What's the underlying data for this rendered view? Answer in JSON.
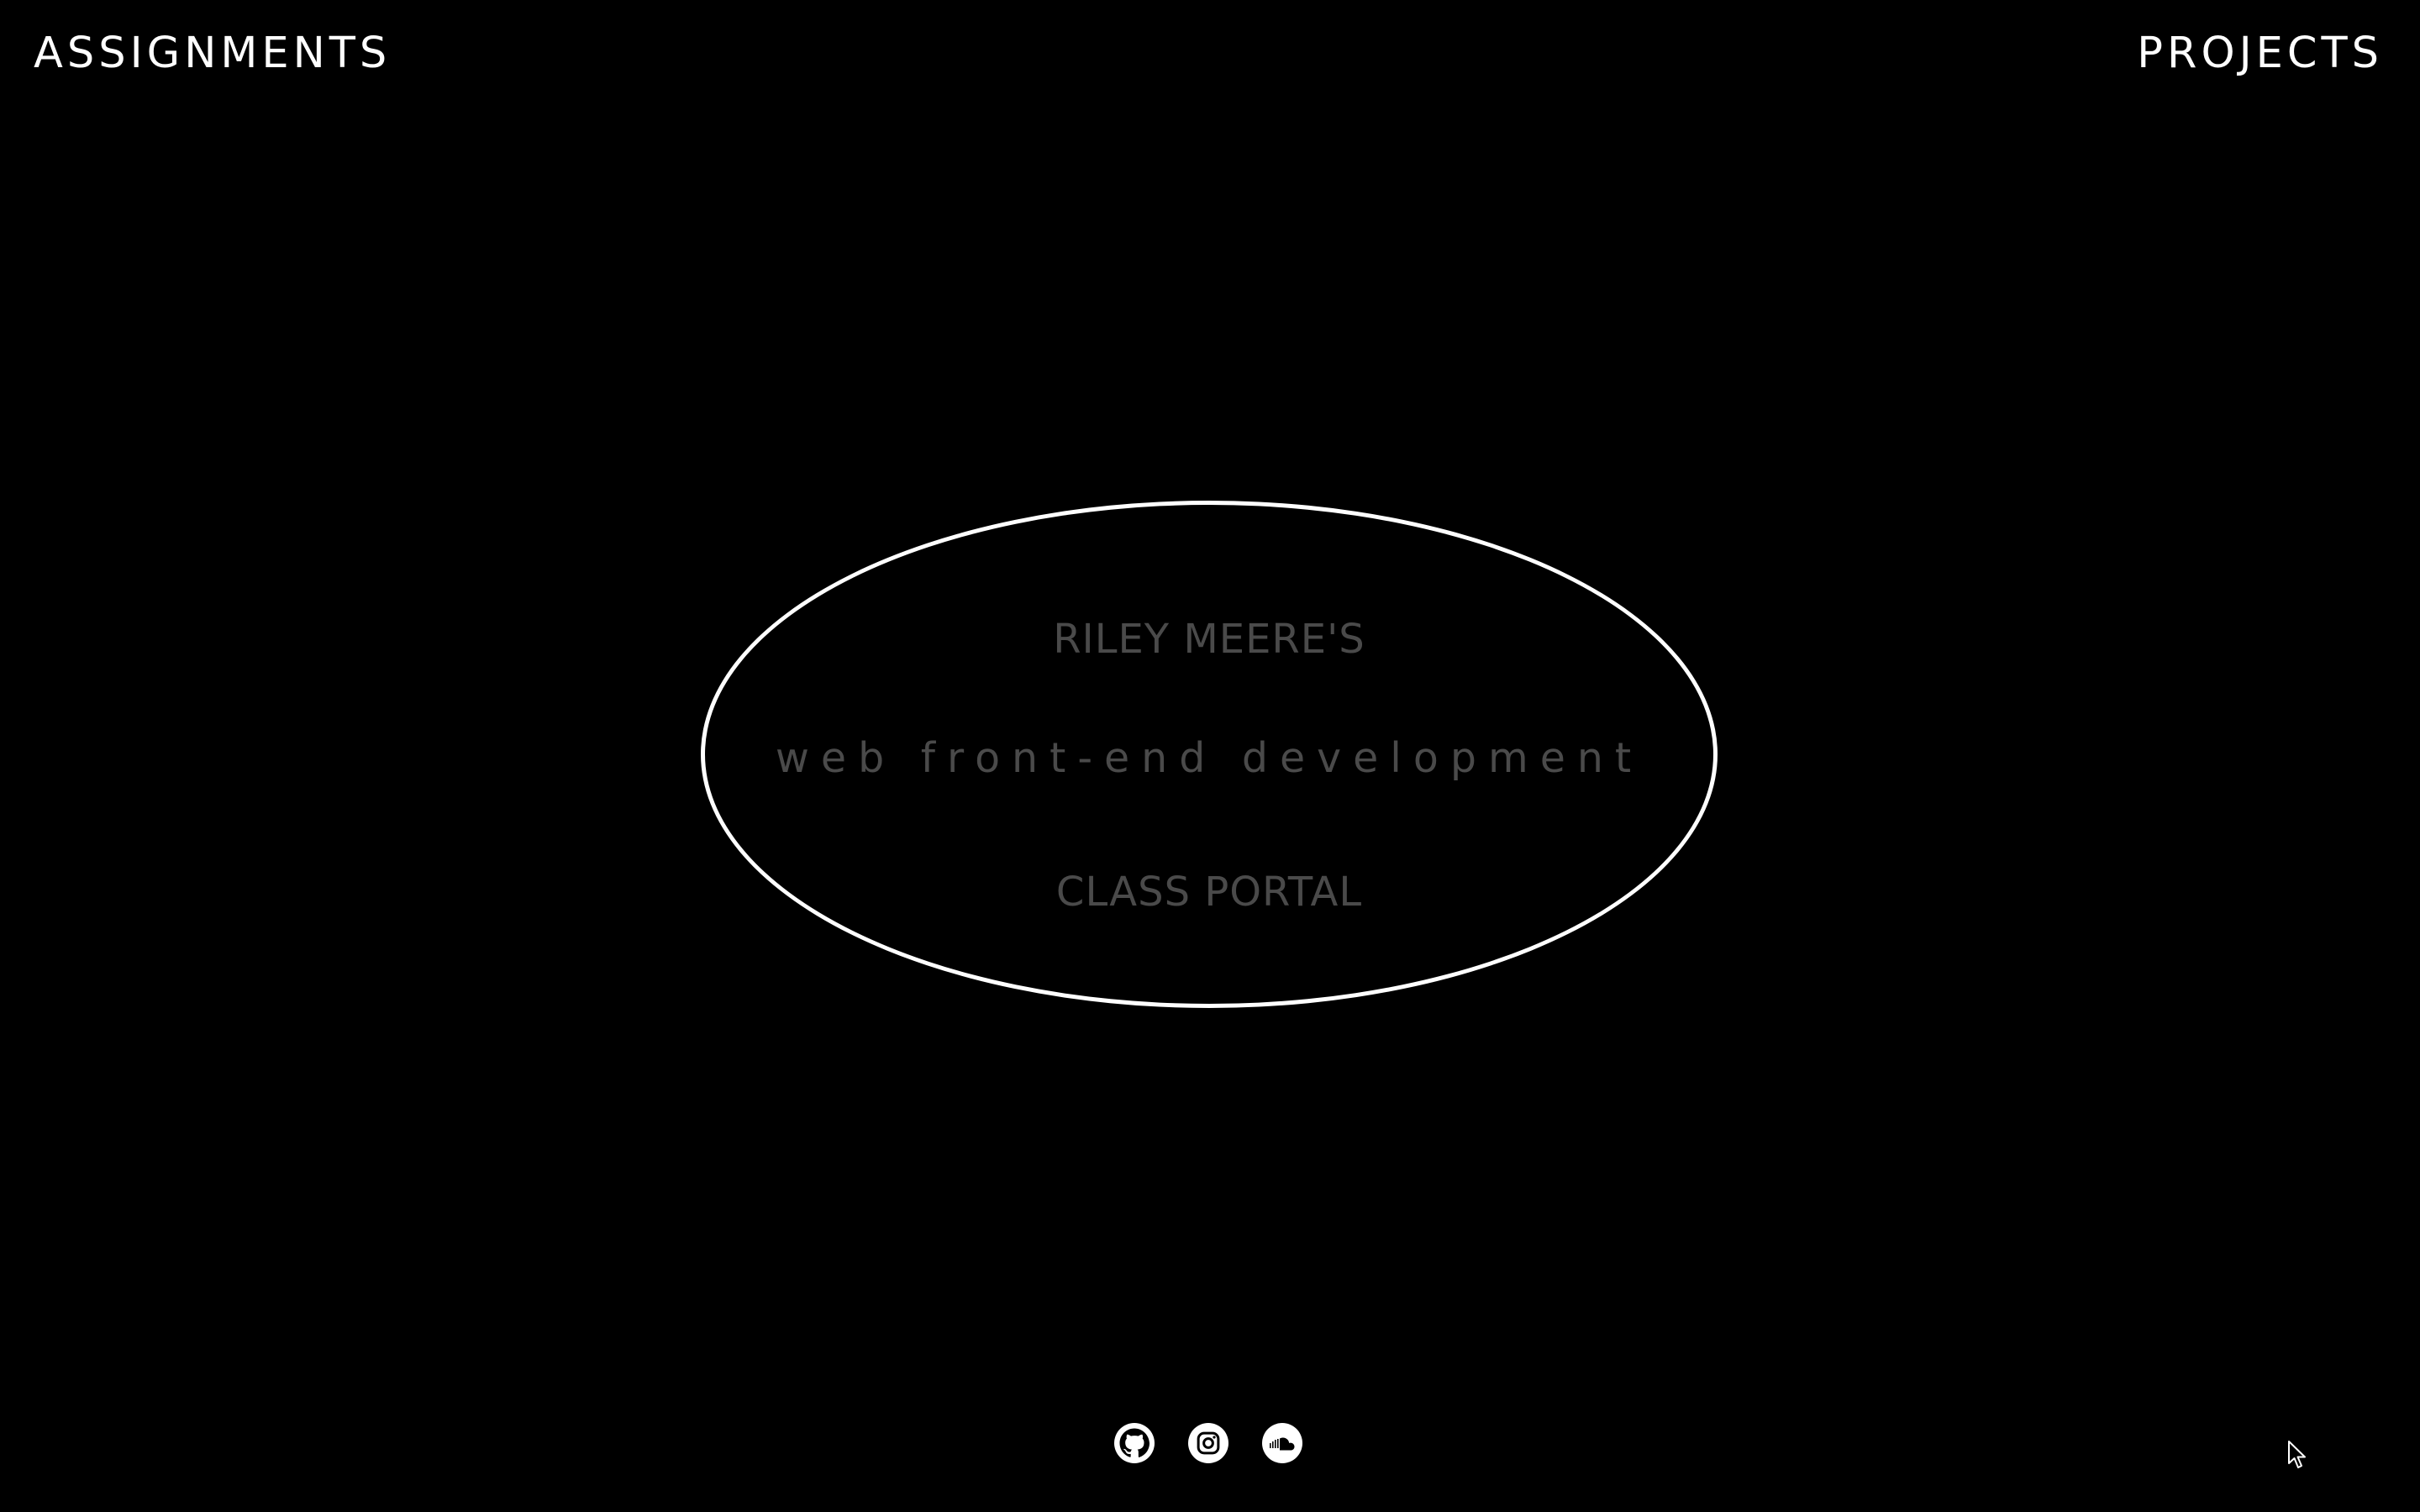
{
  "nav": {
    "left_label": "ASSIGNMENTS",
    "right_label": "PROJECTS"
  },
  "hero": {
    "line1": "RILEY MEERE'S",
    "line2": "web front-end development",
    "line3": "CLASS PORTAL"
  },
  "socials": [
    {
      "icon": "github-icon"
    },
    {
      "icon": "instagram-icon"
    },
    {
      "icon": "soundcloud-icon"
    }
  ],
  "colors": {
    "background": "#000000",
    "nav_text": "#ffffff",
    "hero_text": "#4a4a4a",
    "hero_border": "#ffffff"
  }
}
